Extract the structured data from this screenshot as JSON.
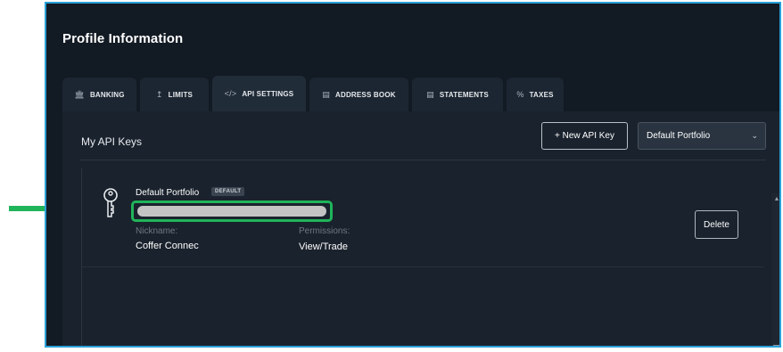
{
  "page": {
    "title": "Profile Information"
  },
  "tabs": [
    {
      "label": "BANKING",
      "icon": "bank-icon"
    },
    {
      "label": "LIMITS",
      "icon": "limits-icon"
    },
    {
      "label": "API SETTINGS",
      "icon": "code-icon"
    },
    {
      "label": "ADDRESS BOOK",
      "icon": "address-book-icon"
    },
    {
      "label": "STATEMENTS",
      "icon": "statement-icon"
    },
    {
      "label": "TAXES",
      "icon": "percent-icon"
    }
  ],
  "active_tab": "API SETTINGS",
  "api_keys": {
    "section_title": "My API Keys",
    "new_key_button": "+ New API Key",
    "portfolio_select": "Default Portfolio",
    "keys": [
      {
        "portfolio": "Default Portfolio",
        "badge": "DEFAULT",
        "nickname_label": "Nickname:",
        "nickname": "Coffer Connec",
        "permissions_label": "Permissions:",
        "permissions": "View/Trade",
        "delete_button": "Delete"
      }
    ]
  },
  "colors": {
    "background": "#121a23",
    "panel": "#1a222d",
    "highlight": "#20b45a",
    "frame_border": "#2aa0d8"
  }
}
